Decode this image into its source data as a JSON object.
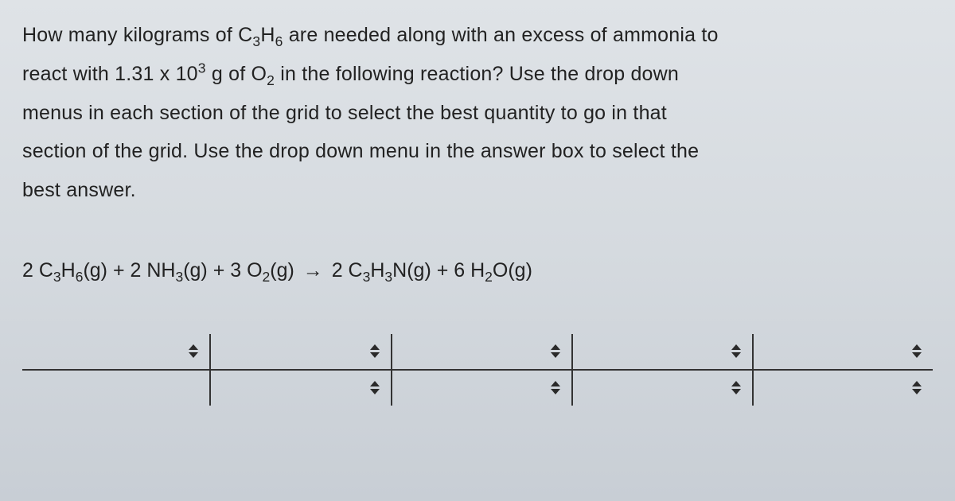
{
  "question": {
    "p1_a": "How many kilograms of C",
    "p1_b": "H",
    "p1_c": " are needed along with an excess of ammonia to",
    "p2_a": "react with 1.31 x 10",
    "p2_b": " g of O",
    "p2_c": " in the following reaction?  Use the drop down",
    "p3": "menus in each section of the grid to select the best quantity to go in that",
    "p4": "section of the grid.  Use the drop down menu in the answer box to select the",
    "p5": "best answer."
  },
  "equation": {
    "t1": "2 C",
    "t2": "H",
    "t3": "(g) + 2 NH",
    "t4": "(g) + 3 O",
    "t5": "(g) ",
    "arrow": "→",
    "t6": " 2 C",
    "t7": "H",
    "t8": "N(g) + 6 H",
    "t9": "O(g)"
  },
  "sub": {
    "three": "3",
    "six": "6",
    "two": "2"
  },
  "sup": {
    "three": "3"
  }
}
